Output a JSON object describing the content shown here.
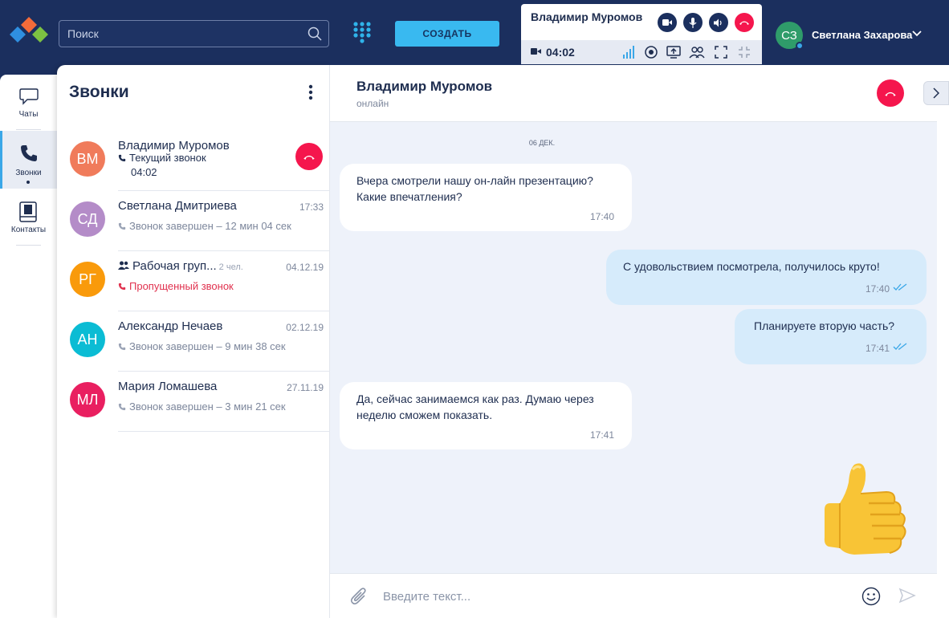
{
  "search": {
    "placeholder": "Поиск"
  },
  "toolbar": {
    "create_label": "СОЗДАТЬ"
  },
  "call_panel": {
    "name": "Владимир Муромов",
    "duration": "04:02"
  },
  "user": {
    "initials": "СЗ",
    "name": "Светлана Захарова"
  },
  "nav": [
    {
      "label": "Чаты"
    },
    {
      "label": "Звонки"
    },
    {
      "label": "Контакты"
    }
  ],
  "calls": {
    "title": "Звонки",
    "items": [
      {
        "initials": "ВМ",
        "name": "Владимир Муромов",
        "status": "Текущий звонок",
        "duration": "04:02",
        "color": "#f07b5b"
      },
      {
        "initials": "СД",
        "name": "Светлана Дмитриева",
        "time": "17:33",
        "status": "Звонок завершен – 12 мин 04 сек",
        "color": "#b48cc8"
      },
      {
        "initials": "РГ",
        "name": "Рабочая груп...",
        "members": "2 чел.",
        "time": "04.12.19",
        "status": "Пропущенный звонок",
        "color": "#f99a0b"
      },
      {
        "initials": "АН",
        "name": "Александр Нечаев",
        "time": "02.12.19",
        "status": "Звонок завершен – 9 мин 38 сек",
        "color": "#0bbcd4"
      },
      {
        "initials": "МЛ",
        "name": "Мария Ломашева",
        "time": "27.11.19",
        "status": "Звонок завершен – 3 мин 21 сек",
        "color": "#e91f60"
      }
    ]
  },
  "chat": {
    "name": "Владимир Муромов",
    "status": "онлайн",
    "date": "06 ДЕК.",
    "messages": [
      {
        "text1": "Вчера смотрели нашу он-лайн презентацию?",
        "text2": "Какие впечатления?",
        "time": "17:40"
      },
      {
        "text1": "С удовольствием посмотрела, получилось круто!",
        "time": "17:40"
      },
      {
        "text1": "Планируете вторую часть?",
        "time": "17:41"
      },
      {
        "text1": "Да, сейчас занимаемся как раз. Думаю через",
        "text2": "неделю сможем показать.",
        "time": "17:41"
      }
    ],
    "composer_placeholder": "Введите текст..."
  }
}
